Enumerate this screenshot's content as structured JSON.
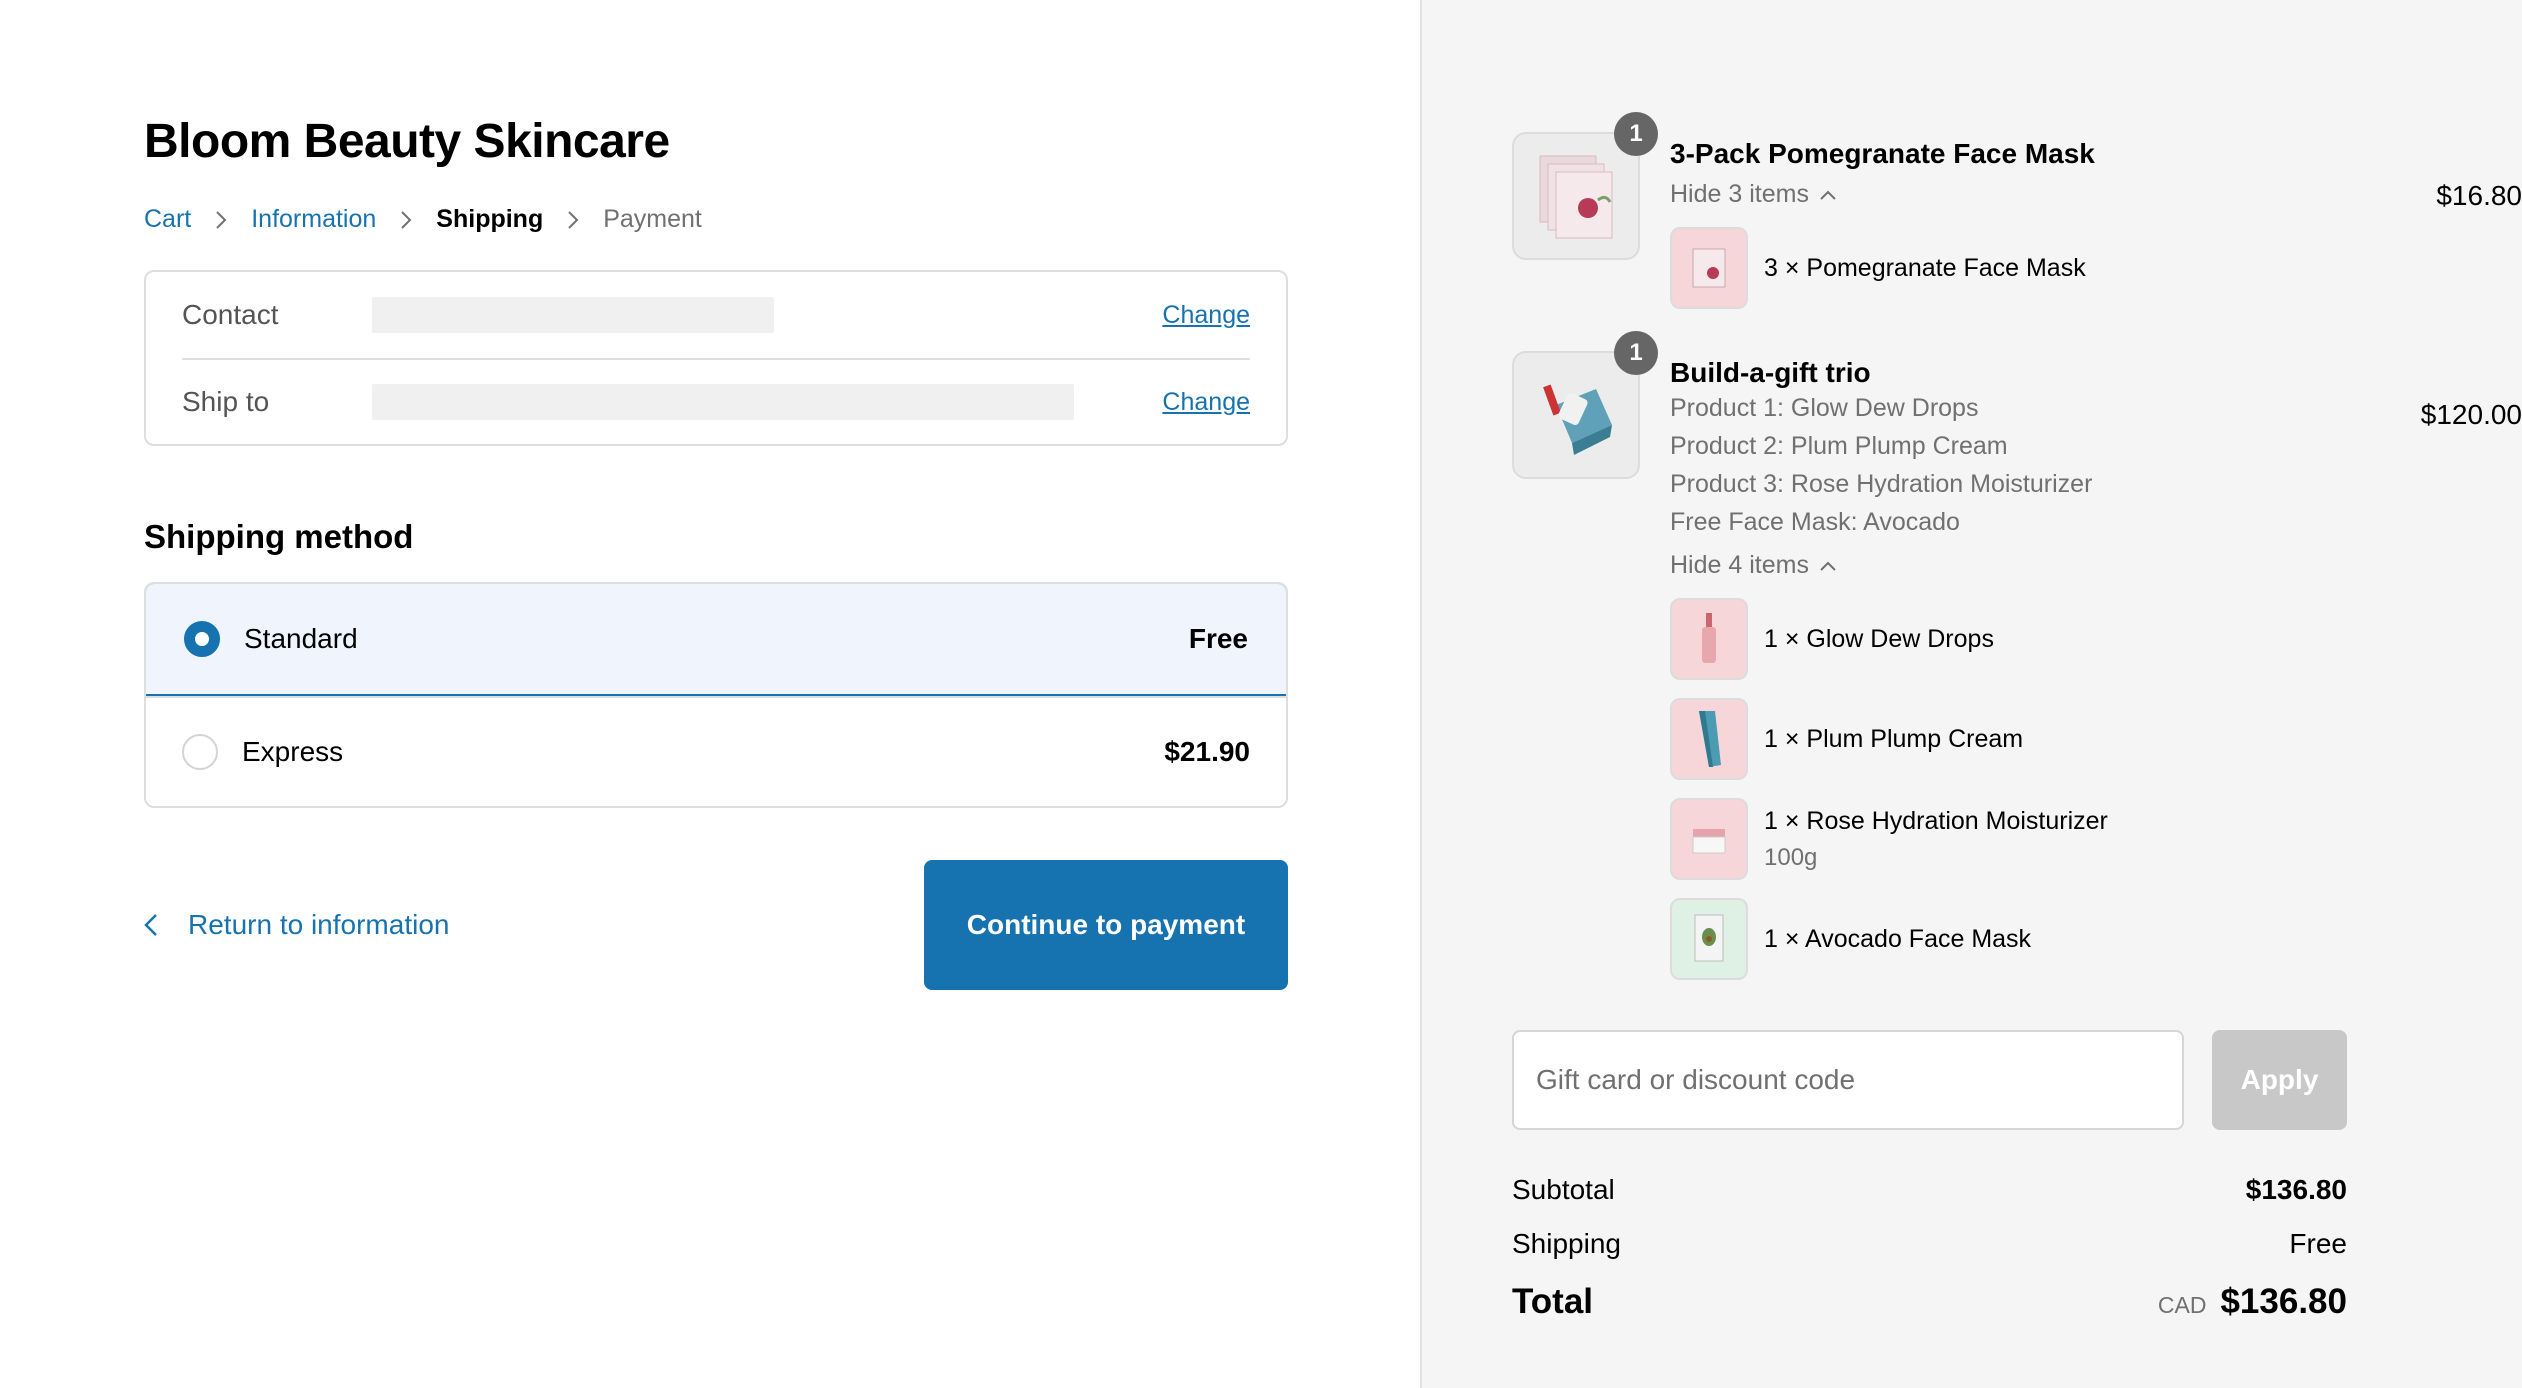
{
  "shop": {
    "title": "Bloom Beauty Skincare"
  },
  "breadcrumb": {
    "cart": "Cart",
    "information": "Information",
    "shipping": "Shipping",
    "payment": "Payment"
  },
  "review": {
    "contact_label": "Contact",
    "ship_to_label": "Ship to",
    "change_label": "Change"
  },
  "shipping_method": {
    "title": "Shipping method",
    "options": [
      {
        "label": "Standard",
        "price": "Free",
        "selected": true
      },
      {
        "label": "Express",
        "price": "$21.90",
        "selected": false
      }
    ]
  },
  "actions": {
    "return_label": "Return to information",
    "continue_label": "Continue to payment"
  },
  "order": {
    "items": [
      {
        "name": "3-Pack Pomegranate Face Mask",
        "quantity": "1",
        "price": "$16.80",
        "toggle": "Hide 3 items",
        "sub_items": [
          {
            "label": "3 × Pomegranate Face Mask"
          }
        ]
      },
      {
        "name": "Build-a-gift trio",
        "quantity": "1",
        "price": "$120.00",
        "properties": [
          "Product 1: Glow Dew Drops",
          "Product 2: Plum Plump Cream",
          "Product 3: Rose Hydration Moisturizer",
          "Free Face Mask: Avocado"
        ],
        "toggle": "Hide 4 items",
        "sub_items": [
          {
            "label": "1 × Glow Dew Drops"
          },
          {
            "label": "1 × Plum Plump Cream"
          },
          {
            "label": "1 × Rose Hydration Moisturizer",
            "variant": "100g"
          },
          {
            "label": "1 × Avocado Face Mask"
          }
        ]
      }
    ],
    "discount": {
      "placeholder": "Gift card or discount code",
      "apply_label": "Apply"
    },
    "subtotal_label": "Subtotal",
    "subtotal": "$136.80",
    "shipping_label": "Shipping",
    "shipping": "Free",
    "total_label": "Total",
    "currency": "CAD",
    "total": "$136.80"
  },
  "colors": {
    "accent": "#1773b0",
    "muted": "#707070",
    "sidebar_bg": "#f5f5f5"
  }
}
